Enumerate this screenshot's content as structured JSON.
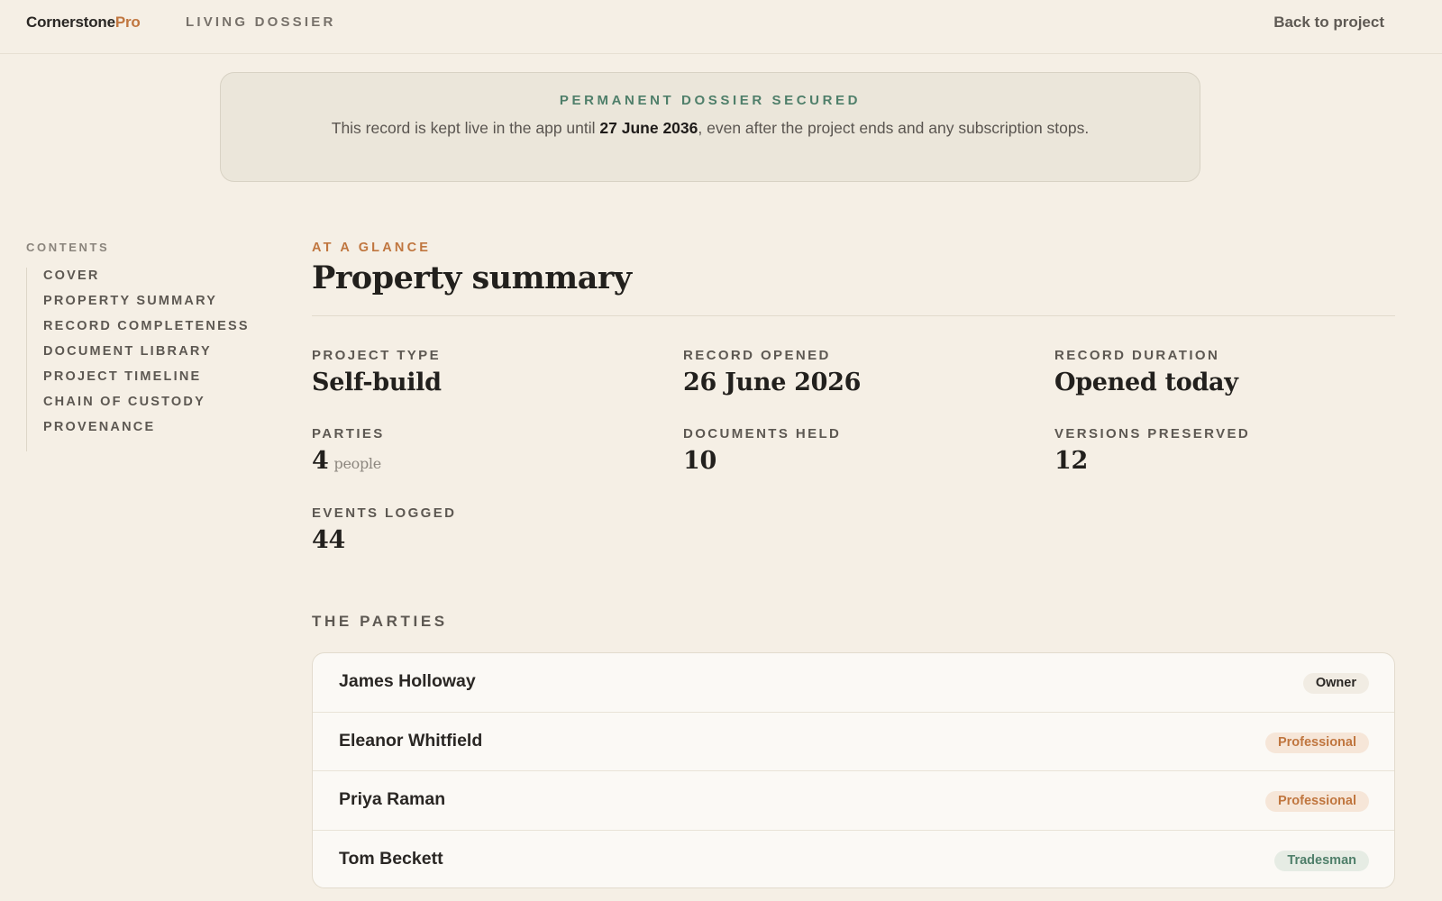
{
  "header": {
    "brand_main": "Cornerstone",
    "brand_accent": "Pro",
    "subtitle": "LIVING DOSSIER",
    "back_link": "Back to project"
  },
  "banner": {
    "title": "PERMANENT DOSSIER SECURED",
    "text_before": "This record is kept live in the app until ",
    "date": "27 June 2036",
    "text_after": ", even after the project ends and any subscription stops."
  },
  "sidebar": {
    "heading": "CONTENTS",
    "items": [
      {
        "label": "COVER"
      },
      {
        "label": "PROPERTY SUMMARY"
      },
      {
        "label": "RECORD COMPLETENESS"
      },
      {
        "label": "DOCUMENT LIBRARY"
      },
      {
        "label": "PROJECT TIMELINE"
      },
      {
        "label": "CHAIN OF CUSTODY"
      },
      {
        "label": "PROVENANCE"
      }
    ]
  },
  "main": {
    "eyebrow": "AT A GLANCE",
    "title": "Property summary",
    "stats": {
      "project_type": {
        "label": "PROJECT TYPE",
        "value": "Self-build"
      },
      "record_opened": {
        "label": "RECORD OPENED",
        "value": "26 June 2026"
      },
      "record_duration": {
        "label": "RECORD DURATION",
        "value": "Opened today"
      },
      "parties": {
        "label": "PARTIES",
        "value": "4",
        "unit": "people"
      },
      "documents_held": {
        "label": "DOCUMENTS HELD",
        "value": "10"
      },
      "versions_preserved": {
        "label": "VERSIONS PRESERVED",
        "value": "12"
      },
      "events_logged": {
        "label": "EVENTS LOGGED",
        "value": "44"
      }
    },
    "parties_heading": "THE PARTIES",
    "parties": [
      {
        "name": "James Holloway",
        "role": "Owner"
      },
      {
        "name": "Eleanor Whitfield",
        "role": "Professional"
      },
      {
        "name": "Priya Raman",
        "role": "Professional"
      },
      {
        "name": "Tom Beckett",
        "role": "Tradesman"
      }
    ]
  }
}
